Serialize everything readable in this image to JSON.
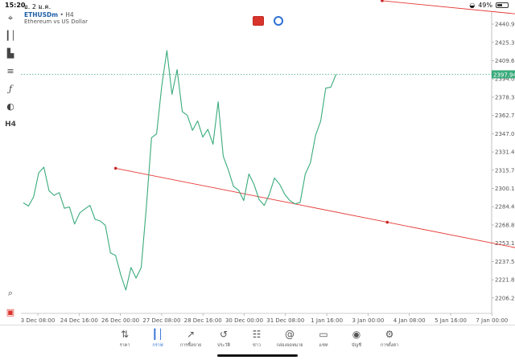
{
  "status": {
    "time": "15:20",
    "date": "อ. 2 ม.ค.",
    "battery": "49%",
    "battery_level": 0.49
  },
  "symbol": {
    "name": "ETHUSDm",
    "timeframe": "• H4",
    "description": "Ethereum vs US Dollar"
  },
  "toolbar": [
    "crosshair-icon",
    "candles-icon",
    "indicators-icon",
    "objects-icon",
    "function-icon",
    "shapes-icon"
  ],
  "toolbar_label": "H4",
  "price_tag": "2397.94",
  "chart_data": {
    "type": "line",
    "title": "",
    "x_labels": [
      "3 Dec 08:00",
      "24 Dec 16:00",
      "26 Dec 00:00",
      "27 Dec 08:00",
      "28 Dec 16:00",
      "30 Dec 00:00",
      "31 Dec 08:00",
      "1 Jan 16:00",
      "3 Jan 00:00",
      "4 Jan 08:00",
      "5 Jan 16:00",
      "7 Jan 00:00"
    ],
    "y_ticks": [
      2206.2,
      2221.85,
      2237.5,
      2253.15,
      2268.8,
      2284.45,
      2300.1,
      2315.75,
      2331.4,
      2347.05,
      2362.7,
      2378.35,
      2394.0,
      2409.65,
      2425.3,
      2440.95
    ],
    "y_tick_labels": [
      "2206.20",
      "2221.85",
      "2237.50",
      "2253.15",
      "2268.80",
      "2284.45",
      "2300.10",
      "2315.75",
      "2331.40",
      "2347.05",
      "2362.70",
      "2378.35",
      "2394.00",
      "2409.65",
      "2425.30",
      "2440.95"
    ],
    "ylim": [
      2193.0,
      2452.0
    ],
    "current_price": 2397.94,
    "line_color": "#3aab7c",
    "trendline_color": "#e53935",
    "price": [
      2287.8,
      2285.0,
      2292.8,
      2313.5,
      2318.4,
      2298.2,
      2294.2,
      2296.5,
      2283.1,
      2284.3,
      2269.6,
      2279.1,
      2282.5,
      2285.6,
      2273.6,
      2272.2,
      2268.5,
      2244.8,
      2242.6,
      2226.2,
      2213.0,
      2232.3,
      2223.3,
      2232.3,
      2284.4,
      2343.6,
      2346.9,
      2387.8,
      2418.3,
      2380.8,
      2402.0,
      2366.0,
      2362.7,
      2349.9,
      2358.0,
      2344.1,
      2350.9,
      2338.0,
      2374.4,
      2327.8,
      2315.8,
      2301.8,
      2298.7,
      2289.7,
      2312.5,
      2303.7,
      2290.6,
      2285.6,
      2295.2,
      2309.1,
      2303.7,
      2295.0,
      2289.7,
      2286.9,
      2288.1,
      2312.5,
      2321.9,
      2345.5,
      2357.8,
      2386.1,
      2387.0,
      2397.9
    ],
    "trendlines": [
      {
        "from_index": 18,
        "from_price": 2317.4,
        "to_index": 124,
        "to_price": 2224.9
      },
      {
        "from_index": 70,
        "from_price": 2461.0,
        "to_index": 125,
        "to_price": 2437.3
      }
    ],
    "grid": false,
    "legend": ""
  },
  "tabs": [
    {
      "icon": "quotes-icon",
      "label": "ราคา",
      "active": false
    },
    {
      "icon": "chart-icon",
      "label": "กราฟ",
      "active": true
    },
    {
      "icon": "trade-icon",
      "label": "การซื้อขาย",
      "active": false
    },
    {
      "icon": "history-icon",
      "label": "ประวัติ",
      "active": false
    },
    {
      "icon": "news-icon",
      "label": "ข่าว",
      "active": false
    },
    {
      "icon": "mailbox-icon",
      "label": "กล่องจดหมาย",
      "active": false
    },
    {
      "icon": "chat-icon",
      "label": "แชท",
      "active": false
    },
    {
      "icon": "account-icon",
      "label": "บัญชี",
      "active": false
    },
    {
      "icon": "settings-icon",
      "label": "การตั้งค่า",
      "active": false
    }
  ]
}
